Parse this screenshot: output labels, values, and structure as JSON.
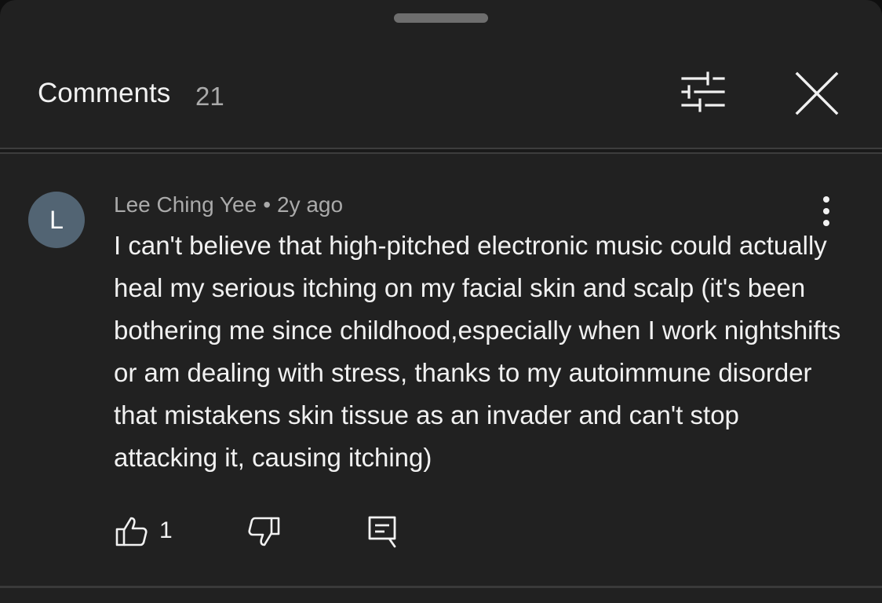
{
  "header": {
    "title": "Comments",
    "count": "21",
    "filter_icon": "sliders-icon",
    "close_icon": "close-icon"
  },
  "comment": {
    "avatar_initial": "L",
    "author": "Lee Ching Yee",
    "separator": "•",
    "time": "2y ago",
    "text": "I can't believe that high-pitched electronic music could actually heal my serious itching on my facial skin and scalp (it's been bothering me since childhood,especially when I work nightshifts or am dealing with stress, thanks to my autoimmune disorder that mistakens skin tissue as an invader and can't stop attacking it, causing itching)",
    "like_count": "1",
    "more_icon": "more-vertical-icon",
    "like_icon": "thumbs-up-icon",
    "dislike_icon": "thumbs-down-icon",
    "reply_icon": "reply-icon"
  },
  "colors": {
    "sheet_background": "#212121",
    "avatar_background": "#526473",
    "primary_text": "#f1f1f1",
    "secondary_text": "#aaaaaa"
  }
}
